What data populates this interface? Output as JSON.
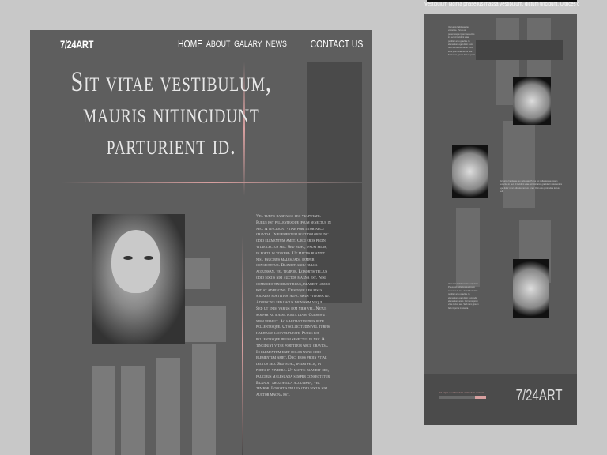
{
  "main": {
    "logo": "7/24ART",
    "menu": [
      "HOME",
      "ABOUT",
      "GALARY",
      "NEWS"
    ],
    "contact": "CONTACT US",
    "hero": "Sit vitae vestibulum, mauris nitincidunt parturient id.",
    "body": "Vel turpis habitasse leo vulputate. Purus est pellentesque ipsum senectus in nec. A tincidunt vitae porttitor arcu gravida. In elementum eget dolor nunc odio elementum amet. Orci eros proin vitae lectus sed. Sed nunc, ipsum felis, in porta in viverra. Ut mattis blandit nisi, faucibus malesuada semper consectetur. Blandit arcu nulla accumsan, vel tempor. Lobortis tellus odio sociis nisi auctor magna est. Nisl commodo tincidunt risus, blandit libero est at adipiscing. Tristique leo risus sodales porttitor nunc risus viverra id. Adipiscing sed lacus dignissim neque. Sed ut enim varius sem nibh vel. Netus semper ac massa porta diam. Cursus ut nibh nibh ut. Ac habitant in duis pede pellentesque. Ut sollicitudin vel turpis habitasse leo vulputate. Purus est pellentesque ipsum senectus in nec. A tincidunt vitae porttitor arcu gravida. In elementum eget dolor nunc odio elementum amet. Orci eros proin vitae lectus sed. Sed nunc, ipsum felis, in porta in viverra. Ut mattis blandit nisi, faucibus malesuada semper consectetur. Blandit arcu nulla accumsan, vel tempor. Lobortis tellus odio sociis nisi auctor magna est."
  },
  "side": {
    "ticker": "Vestibulum lacinia phasellus massa vestibulum, dictum tincidunt. Ultrices dolor at lectus ul vestib",
    "block1": "Vel turpis habitasse leo vulputate. Purus est pellentesque ipsum senectus in nec. A tincidunt vitae porttitor arcu gravida. In elementum eget dolor nunc odio elementum amet. Orci eros proin vitae lectus sed. Sed nunc, ipsum felis in porta.",
    "block2": "Vel turpis habitasse leo vulputate. Purus est pellentesque ipsum senectus in nec. A tincidunt vitae porttitor arcu gravida. In elementum eget dolor nunc odio elementum amet. Orci eros proin vitae lectus sed.",
    "block3": "Vel turpis habitasse leo vulputate. Purus est pellentesque ipsum senectus in nec. A tincidunt vitae porttitor arcu gravida. In elementum eget dolor nunc odio elementum amet. Orci eros proin vitae lectus sed. Sed nunc, ipsum felis in porta in viverra.",
    "footer_logo": "7/24ART",
    "footer_small": "Vel turpis et ut tincidunt vestibulum molestie"
  }
}
